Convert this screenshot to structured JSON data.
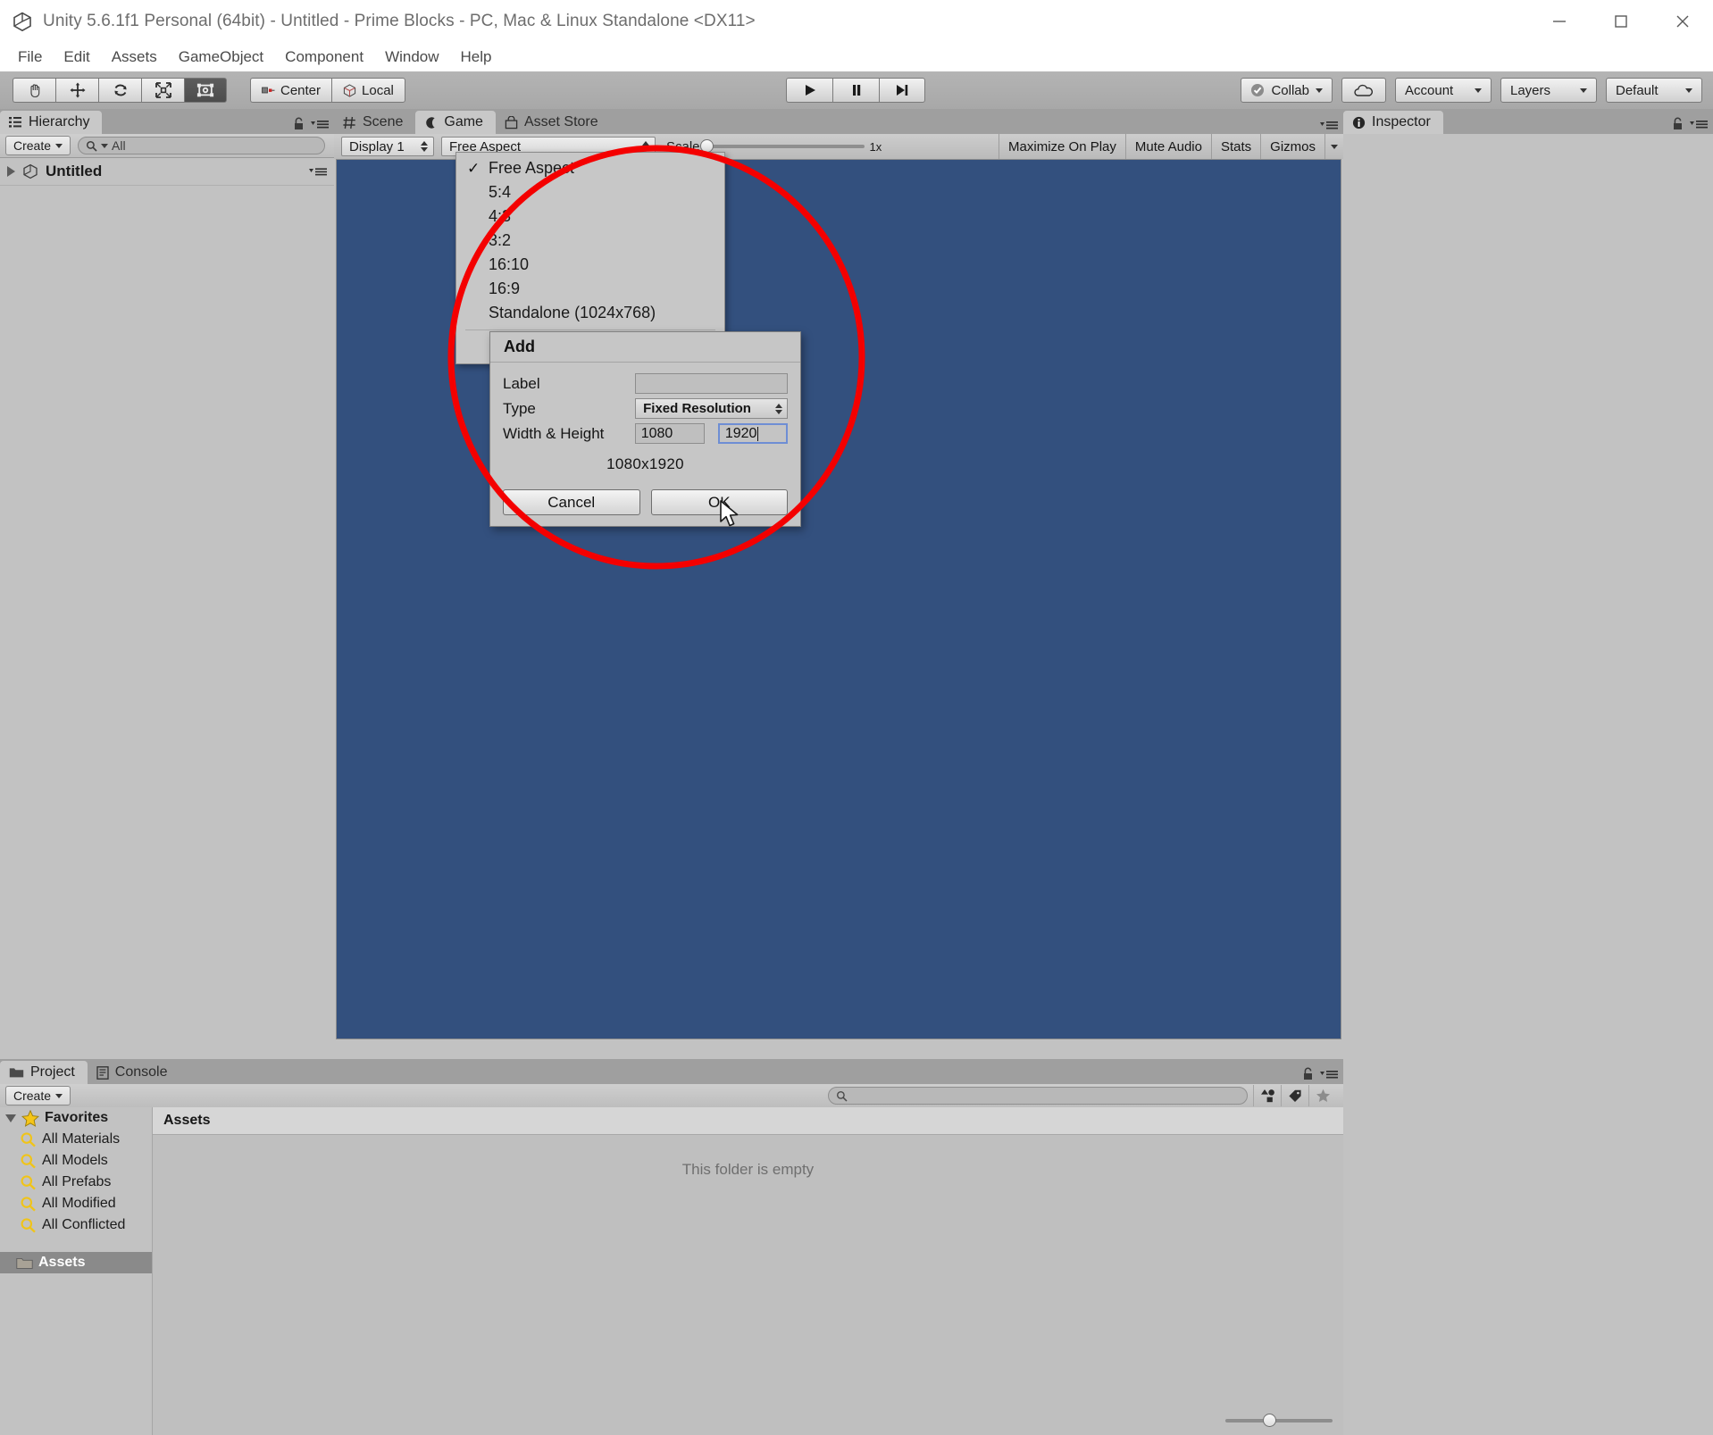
{
  "window": {
    "title": "Unity 5.6.1f1 Personal (64bit) - Untitled - Prime Blocks - PC, Mac & Linux Standalone <DX11>",
    "minimize_label": "—",
    "maximize_label": "☐",
    "close_label": "✕"
  },
  "menubar": {
    "items": [
      "File",
      "Edit",
      "Assets",
      "GameObject",
      "Component",
      "Window",
      "Help"
    ]
  },
  "toolbar": {
    "transform_tools": [
      {
        "name": "hand-tool",
        "icon": "hand-icon",
        "active": false
      },
      {
        "name": "move-tool",
        "icon": "move-icon",
        "active": false
      },
      {
        "name": "rotate-tool",
        "icon": "rotate-icon",
        "active": false
      },
      {
        "name": "scale-tool",
        "icon": "scale-icon",
        "active": false
      },
      {
        "name": "rect-tool",
        "icon": "rect-transform-icon",
        "active": true
      }
    ],
    "pivot_label": "Center",
    "space_label": "Local",
    "play_label": "▶",
    "pause_label": "‖",
    "step_label": "▶|",
    "collab_label": "Collab",
    "cloud_label": "",
    "account_label": "Account",
    "layers_label": "Layers",
    "layout_label": "Default"
  },
  "hierarchy": {
    "tab_label": "Hierarchy",
    "create_label": "Create",
    "search_value": "All",
    "scene_name": "Untitled"
  },
  "center": {
    "tabs": [
      {
        "label": "Scene",
        "icon": "scene-grid-icon",
        "active": false
      },
      {
        "label": "Game",
        "icon": "game-pad-icon",
        "active": true
      },
      {
        "label": "Asset Store",
        "icon": "asset-store-icon",
        "active": false
      }
    ],
    "display_label": "Display 1",
    "aspect_label": "Free Aspect",
    "scale_label": "Scale",
    "scale_value": "1x",
    "maximize_label": "Maximize On Play",
    "mute_label": "Mute Audio",
    "stats_label": "Stats",
    "gizmos_label": "Gizmos",
    "canvas_color": "#33507e"
  },
  "aspect_menu": {
    "items": [
      {
        "label": "Free Aspect",
        "checked": true
      },
      {
        "label": "5:4",
        "checked": false
      },
      {
        "label": "4:3",
        "checked": false
      },
      {
        "label": "3:2",
        "checked": false
      },
      {
        "label": "16:10",
        "checked": false
      },
      {
        "label": "16:9",
        "checked": false
      },
      {
        "label": "Standalone (1024x768)",
        "checked": false
      }
    ]
  },
  "add_dialog": {
    "title": "Add",
    "label_field_label": "Label",
    "label_value": "",
    "type_field_label": "Type",
    "type_value": "Fixed Resolution",
    "size_field_label": "Width & Height",
    "width_value": "1080",
    "height_value": "1920",
    "resolution_preview": "1080x1920",
    "cancel_label": "Cancel",
    "ok_label": "OK"
  },
  "inspector": {
    "tab_label": "Inspector"
  },
  "project": {
    "tabs": [
      {
        "label": "Project",
        "icon": "folder-icon",
        "active": true
      },
      {
        "label": "Console",
        "icon": "console-icon",
        "active": false
      }
    ],
    "create_label": "Create",
    "search_placeholder": "",
    "favorites_label": "Favorites",
    "favorites": [
      "All Materials",
      "All Models",
      "All Prefabs",
      "All Modified",
      "All Conflicted"
    ],
    "assets_tree_label": "Assets",
    "assets_header": "Assets",
    "empty_message": "This folder is empty"
  },
  "annotation": {
    "color": "#f40000",
    "shape": "ellipse",
    "stroke_width": 7
  },
  "colors": {
    "accent_red": "#f40000",
    "game_blue": "#33507e",
    "chrome_gray": "#c2c2c2",
    "toolbar_gray": "#a8a8a8",
    "focus_blue": "#6e8ed4"
  }
}
